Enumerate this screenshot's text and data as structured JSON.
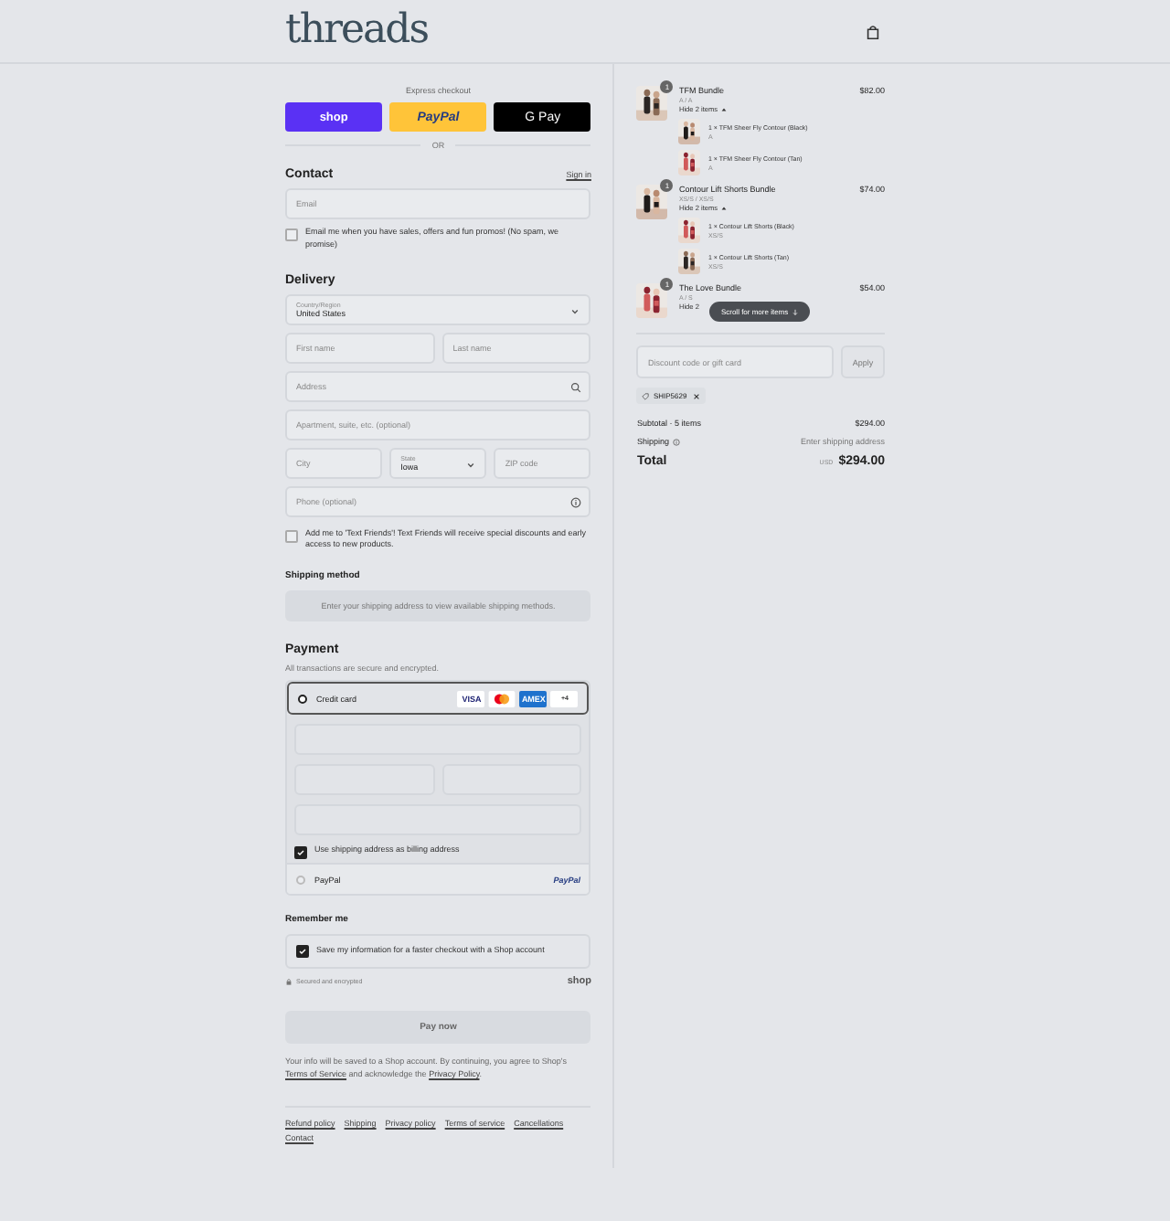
{
  "header": {
    "logo": "threads"
  },
  "express_checkout": {
    "label": "Express checkout",
    "buttons": [
      {
        "kind": "shop",
        "label": "shop"
      },
      {
        "kind": "paypal",
        "label": "PayPal"
      },
      {
        "kind": "gpay",
        "label": "G Pay"
      }
    ],
    "divider": "OR"
  },
  "contact": {
    "title": "Contact",
    "sign_in": "Sign in",
    "email": {
      "placeholder": "Email"
    },
    "marketing": {
      "label": "Email me when you have sales, offers and fun promos! (No spam, we promise)",
      "checked": false
    }
  },
  "delivery": {
    "title": "Delivery",
    "rows": [
      [
        {
          "kind": "select",
          "label": "Country/Region",
          "value": "United States"
        }
      ],
      [
        {
          "kind": "input",
          "placeholder": "First name"
        },
        {
          "kind": "input",
          "placeholder": "Last name"
        }
      ],
      [
        {
          "kind": "input",
          "placeholder": "Address"
        }
      ],
      [
        {
          "kind": "input",
          "placeholder": "Apartment, suite, etc. (optional)"
        }
      ],
      [
        {
          "kind": "input",
          "placeholder": "City"
        },
        {
          "kind": "select",
          "label": "State",
          "value": "Iowa"
        },
        {
          "kind": "input",
          "placeholder": "ZIP code"
        }
      ],
      [
        {
          "kind": "input",
          "placeholder": "Phone (optional)"
        }
      ]
    ],
    "text_friends": {
      "label": "Add me to 'Text Friends'! Text Friends will receive special discounts and early access to new products.",
      "checked": false
    }
  },
  "shipping_method": {
    "title": "Shipping method",
    "notice": "Enter your shipping address to view available shipping methods."
  },
  "payment": {
    "title": "Payment",
    "subtitle": "All transactions are secure and encrypted.",
    "methods": [
      {
        "kind": "card",
        "label": "Credit card",
        "selected": true,
        "brands": [
          {
            "kind": "visa",
            "label": "VISA"
          },
          {
            "kind": "mastercard"
          },
          {
            "kind": "amex",
            "label": "AMEX"
          },
          {
            "kind": "more",
            "label": "+4"
          }
        ],
        "billing": {
          "label": "Use shipping address as billing address",
          "checked": true
        }
      },
      {
        "kind": "paypal",
        "label": "PayPal",
        "selected": false,
        "logo": "PayPal"
      }
    ]
  },
  "remember_me": {
    "title": "Remember me",
    "save": {
      "label": "Save my information for a faster checkout with a Shop account",
      "checked": true
    },
    "secure_note": "Secured and encrypted",
    "shop_logo": "shop"
  },
  "pay_button": "Pay now",
  "disclaimer": [
    {
      "text": "Your info will be saved to a Shop account. By continuing, you agree to Shop's "
    },
    {
      "link": "Terms of Service"
    },
    {
      "text": " and acknowledge the "
    },
    {
      "link": "Privacy Policy"
    },
    {
      "text": "."
    }
  ],
  "footer_links": [
    "Refund policy",
    "Shipping",
    "Privacy policy",
    "Terms of service",
    "Cancellations",
    "Contact"
  ],
  "order_summary": {
    "items": [
      {
        "name": "TFM Bundle",
        "variant": "A / A",
        "price": "$82.00",
        "quantity": "1",
        "toggle": "Hide 2 items",
        "children": [
          {
            "name": "1 × TFM Sheer Fly Contour (Black)",
            "variant": "A"
          },
          {
            "name": "1 × TFM Sheer Fly Contour (Tan)",
            "variant": "A"
          }
        ]
      },
      {
        "name": "Contour Lift Shorts Bundle",
        "variant": "XS/S / XS/S",
        "price": "$74.00",
        "quantity": "1",
        "toggle": "Hide 2 items",
        "children": [
          {
            "name": "1 × Contour Lift Shorts (Black)",
            "variant": "XS/S"
          },
          {
            "name": "1 × Contour Lift Shorts (Tan)",
            "variant": "XS/S"
          }
        ]
      },
      {
        "name": "The Love Bundle",
        "variant": "A / S",
        "price": "$54.00",
        "quantity": "1",
        "toggle": "Hide 2"
      }
    ],
    "scroll_hint": "Scroll for more items",
    "discount": {
      "placeholder": "Discount code or gift card",
      "button": "Apply"
    },
    "codes": [
      {
        "label": "SHIP5629"
      }
    ],
    "subtotal": {
      "label": "Subtotal · 5 items",
      "value": "$294.00"
    },
    "shipping": {
      "label": "Shipping",
      "value": "Enter shipping address"
    },
    "total": {
      "label": "Total",
      "currency": "USD",
      "value": "$294.00"
    }
  }
}
